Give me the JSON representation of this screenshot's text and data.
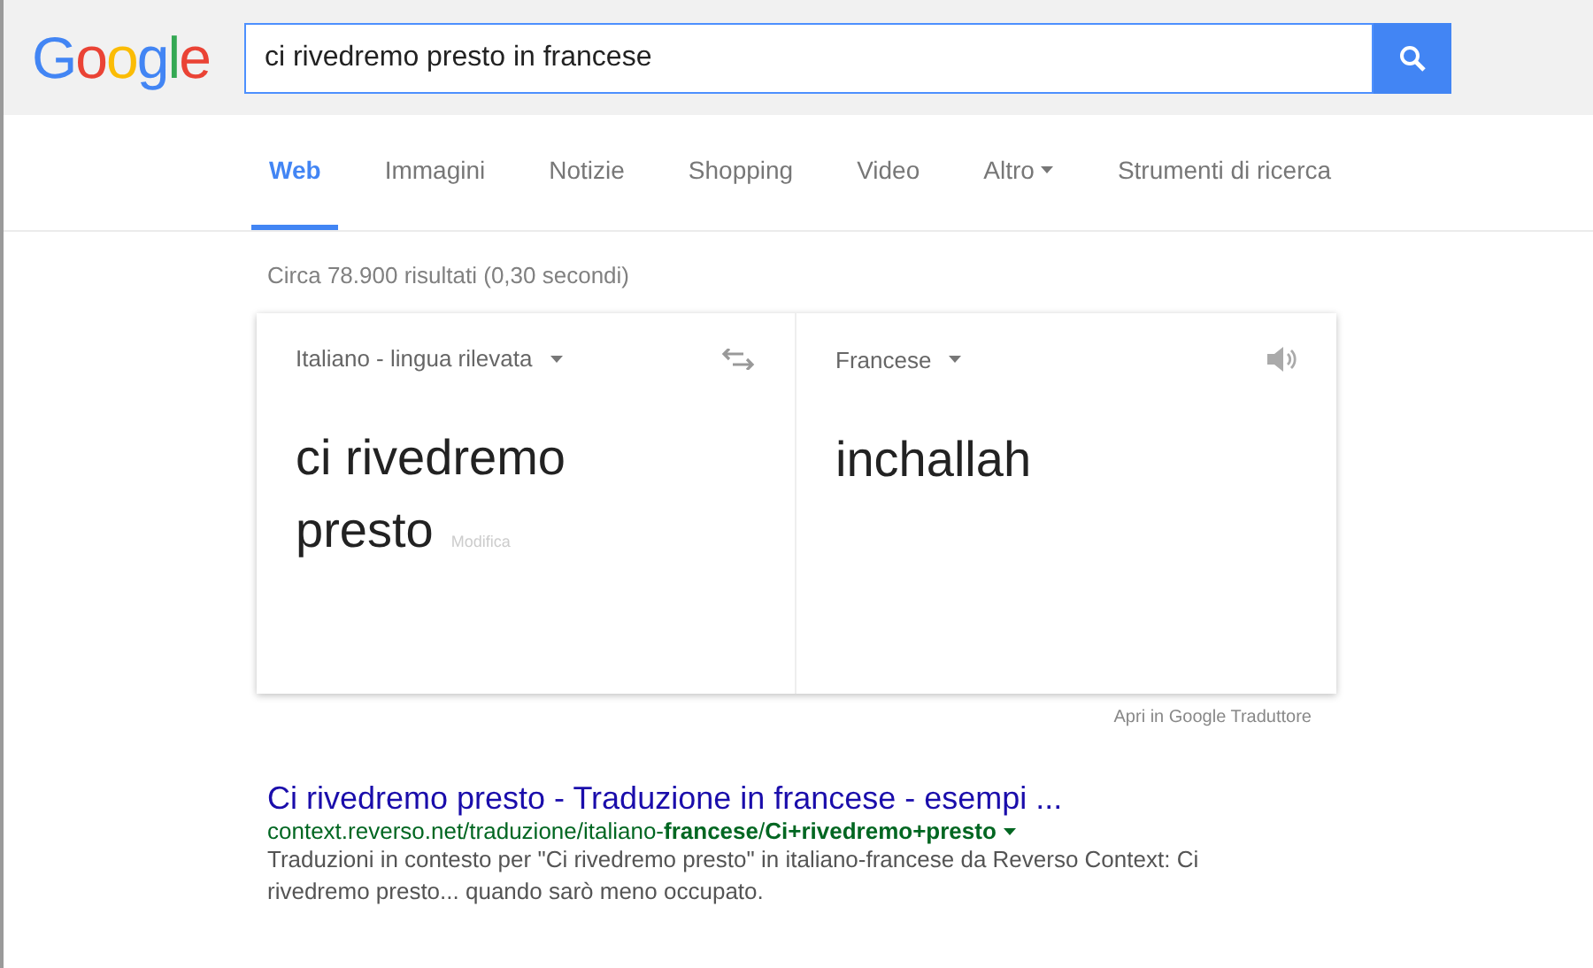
{
  "header": {
    "logo": "Google",
    "search": {
      "value": "ci rivedremo presto in francese"
    }
  },
  "tabs": [
    {
      "label": "Web",
      "selected": true,
      "dropdown": false
    },
    {
      "label": "Immagini",
      "selected": false,
      "dropdown": false
    },
    {
      "label": "Notizie",
      "selected": false,
      "dropdown": false
    },
    {
      "label": "Shopping",
      "selected": false,
      "dropdown": false
    },
    {
      "label": "Video",
      "selected": false,
      "dropdown": false
    },
    {
      "label": "Altro",
      "selected": false,
      "dropdown": true
    },
    {
      "label": "Strumenti di ricerca",
      "selected": false,
      "dropdown": false
    }
  ],
  "result_stats": "Circa 78.900 risultati (0,30 secondi)",
  "translator": {
    "source_language": "Italiano - lingua rilevata",
    "target_language": "Francese",
    "source_text": "ci rivedremo presto",
    "edit_link": "Modifica",
    "translation": "inchallah",
    "open_link": "Apri in Google Traduttore"
  },
  "results": [
    {
      "title": "Ci rivedremo presto - Traduzione in francese - esempi ...",
      "url": "context.reverso.net/traduzione/italiano-**francese**/**Ci+rivedremo+presto**",
      "snippet": "Traduzioni in contesto per \"Ci rivedremo presto\" in italiano-francese da Reverso Context: Ci rivedremo presto... quando sarò meno occupato."
    }
  ]
}
